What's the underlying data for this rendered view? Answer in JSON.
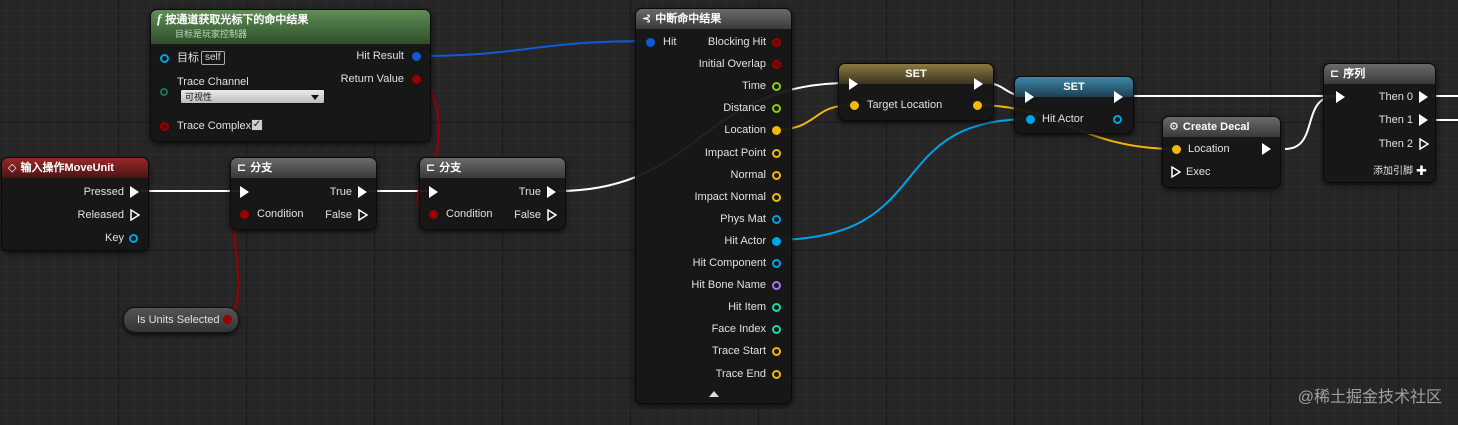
{
  "colors": {
    "exec": "#ffffff",
    "bool": "#9b0000",
    "struct_hit": "#0f5ad6",
    "vector": "#f2b90c",
    "object": "#00a2e8",
    "float": "#8cd000",
    "name": "#b06bff",
    "int": "#1fd7a8",
    "green_pin": "#3cd27a"
  },
  "nodes": {
    "input_action": {
      "icon": "diamond-icon",
      "title": "输入操作MoveUnit",
      "pins": {
        "pressed": "Pressed",
        "released": "Released",
        "key": "Key"
      }
    },
    "get_hit": {
      "icon": "function-icon",
      "icon_glyph": "f",
      "title": "按通道获取光标下的命中结果",
      "subtitle": "目标是玩家控制器",
      "target_label": "目标",
      "target_value": "self",
      "trace_channel_label": "Trace Channel",
      "trace_channel_value": "可视性",
      "trace_complex_label": "Trace Complex",
      "hit_result": "Hit Result",
      "return_value": "Return Value"
    },
    "branch1": {
      "title": "分支",
      "condition": "Condition",
      "true_label": "True",
      "false_label": "False"
    },
    "branch2": {
      "title": "分支",
      "condition": "Condition",
      "true_label": "True",
      "false_label": "False"
    },
    "is_units_selected": {
      "label": "Is Units Selected"
    },
    "break_hit": {
      "title": "中断命中结果",
      "input": "Hit",
      "outputs": [
        "Blocking Hit",
        "Initial Overlap",
        "Time",
        "Distance",
        "Location",
        "Impact Point",
        "Normal",
        "Impact Normal",
        "Phys Mat",
        "Hit Actor",
        "Hit Component",
        "Hit Bone Name",
        "Hit Item",
        "Face Index",
        "Trace Start",
        "Trace End"
      ]
    },
    "set1": {
      "title": "SET",
      "var": "Target Location"
    },
    "set2": {
      "title": "SET",
      "var": "Hit Actor"
    },
    "create_decal": {
      "title": "Create Decal",
      "location": "Location",
      "exec": "Exec"
    },
    "sequence": {
      "title": "序列",
      "outputs": [
        "Then 0",
        "Then 1",
        "Then 2"
      ],
      "add_pin": "添加引脚"
    }
  },
  "watermark": "@稀土掘金技术社区"
}
